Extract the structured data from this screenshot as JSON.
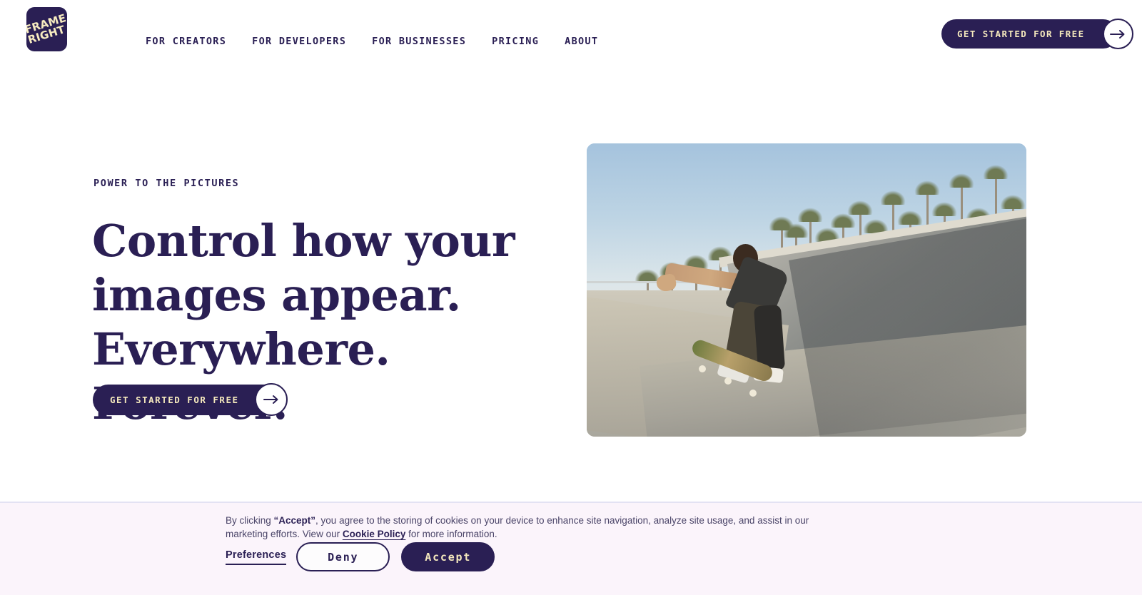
{
  "brand": {
    "logo_line1": "FRAME",
    "logo_line2": "RIGHT",
    "navy": "#2a1f54",
    "cream": "#f5e9bd",
    "banner_bg": "#fbf4fb"
  },
  "header": {
    "nav": [
      {
        "label": "FOR CREATORS"
      },
      {
        "label": "FOR DEVELOPERS"
      },
      {
        "label": "FOR BUSINESSES"
      },
      {
        "label": "PRICING"
      },
      {
        "label": "ABOUT"
      }
    ],
    "cta_label": "GET STARTED FOR FREE"
  },
  "hero": {
    "eyebrow": "POWER TO THE PICTURES",
    "headline": "Control how your images appear. Everywhere. Forever.",
    "cta_label": "GET STARTED FOR FREE",
    "image_alt": "Skateboarder mid-air in a concrete skate park bowl with palm trees and blue sky"
  },
  "cookie_banner": {
    "text_part1": "By clicking ",
    "accept_quoted": "“Accept”",
    "text_part2": ", you agree to the storing of cookies on your device to enhance site navigation, analyze site usage, and assist in our marketing efforts. View our ",
    "policy_link": "Cookie Policy",
    "text_part3": " for more information.",
    "preferences_label": "Preferences",
    "deny_label": "Deny",
    "accept_label": "Accept"
  }
}
